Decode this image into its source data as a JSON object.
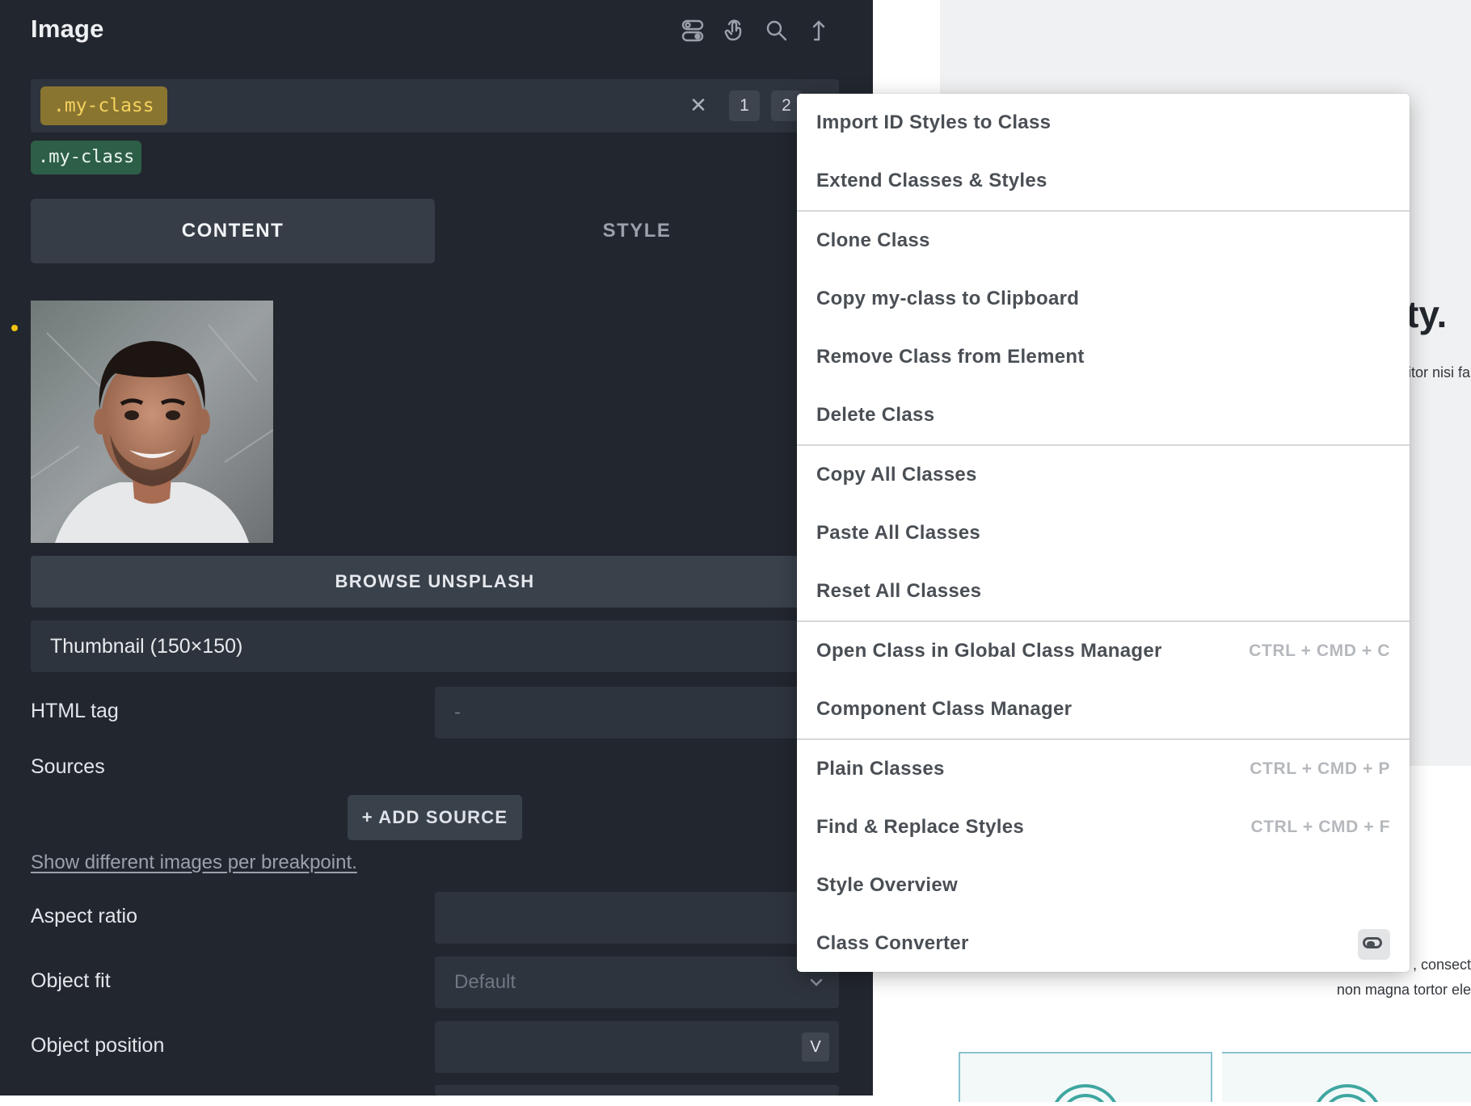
{
  "panel": {
    "title": "Image",
    "header_icons": [
      "toggle-icon",
      "pointer-icon",
      "search-icon",
      "share-icon"
    ],
    "class_bar": {
      "active_class": ".my-class",
      "badges": [
        "1",
        "2"
      ]
    },
    "secondary_class": ".my-class",
    "tabs": [
      {
        "label": "CONTENT",
        "active": true
      },
      {
        "label": "STYLE",
        "active": false
      }
    ],
    "browse_button": "BROWSE UNSPLASH",
    "image_size": "Thumbnail (150×150)",
    "fields": {
      "html_tag": {
        "label": "HTML tag",
        "placeholder": "-"
      },
      "sources": {
        "label": "Sources",
        "button": "+ ADD SOURCE"
      },
      "breakpoint_link": "Show different images per breakpoint.",
      "aspect_ratio": {
        "label": "Aspect ratio"
      },
      "object_fit": {
        "label": "Object fit",
        "placeholder": "Default"
      },
      "object_position": {
        "label": "Object position",
        "badge": "V"
      }
    }
  },
  "preview": {
    "heading_fragment": "ty.",
    "text_fragment_1": "itor nisi fa",
    "text_fragment_2": ", consect",
    "text_fragment_3": "non magna tortor ele"
  },
  "context_menu": {
    "groups": [
      [
        {
          "label": "Import ID Styles to Class"
        },
        {
          "label": "Extend Classes & Styles"
        }
      ],
      [
        {
          "label": "Clone Class"
        },
        {
          "label": "Copy my-class to Clipboard"
        },
        {
          "label": "Remove Class from Element"
        },
        {
          "label": "Delete Class"
        }
      ],
      [
        {
          "label": "Copy All Classes"
        },
        {
          "label": "Paste All Classes"
        },
        {
          "label": "Reset All Classes"
        }
      ],
      [
        {
          "label": "Open Class in Global Class Manager",
          "shortcut": "CTRL + CMD + C"
        },
        {
          "label": "Component Class Manager"
        }
      ],
      [
        {
          "label": "Plain Classes",
          "shortcut": "CTRL + CMD + P"
        },
        {
          "label": "Find & Replace Styles",
          "shortcut": "CTRL + CMD + F"
        },
        {
          "label": "Style Overview"
        },
        {
          "label": "Class Converter",
          "toggle": true
        }
      ]
    ]
  },
  "colors": {
    "panel_bg": "#22262e",
    "class_chip_bg": "#8a7530",
    "class_chip_text": "#f4d35e",
    "green_chip_bg": "#2d5e47"
  }
}
